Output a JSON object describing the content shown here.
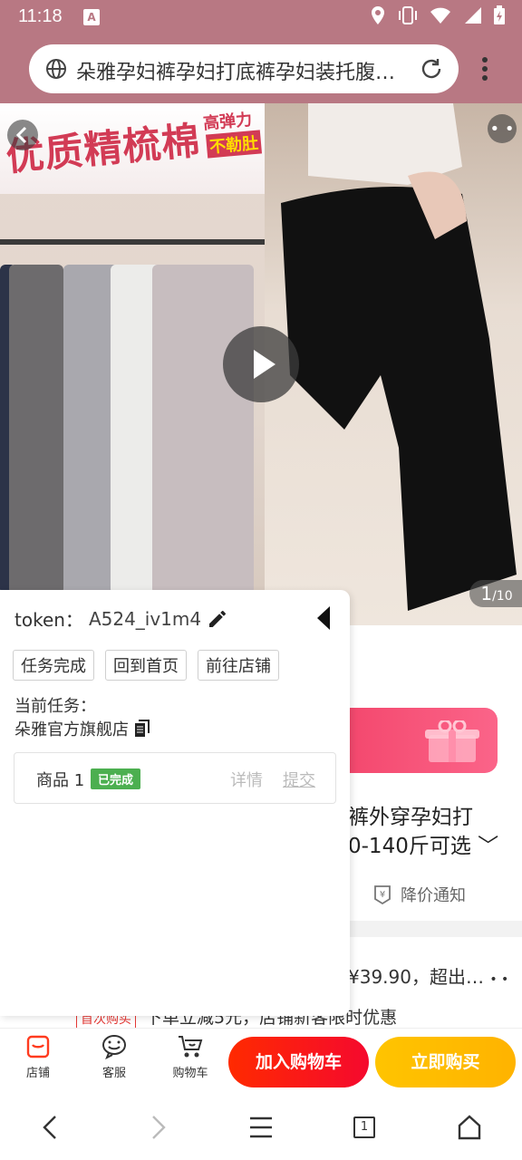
{
  "status_bar": {
    "time": "11:18",
    "notification_icon": "A"
  },
  "browser": {
    "url_title": "朵雅孕妇裤孕妇打底裤孕妇装托腹…",
    "tab_count": "1"
  },
  "hero": {
    "slogan_main": "优质精梳棉",
    "slogan_sub1": "高弹力",
    "slogan_sub2": "不勒肚",
    "counter_current": "1",
    "counter_total": "/10"
  },
  "panel": {
    "token_label": "token：",
    "token_value": "A524_iv1m4",
    "buttons": [
      "任务完成",
      "回到首页",
      "前往店铺"
    ],
    "task_label": "当前任务：",
    "task_name": "朵雅官方旗舰店",
    "card": {
      "name": "商品 1",
      "badge": "已完成",
      "detail": "详情",
      "submit": "提交"
    }
  },
  "page": {
    "title_line1": "裤外穿孕妇打",
    "title_line2": "0-140斤可选",
    "price_notify": "降价通知",
    "price_fragment": "¥39.90，超出…",
    "promo_tag": "首次购买",
    "promo_text": "下单立减5元，店铺新客限时优惠"
  },
  "action_bar": {
    "shop_label": "店铺",
    "service_label": "客服",
    "cart_label": "购物车",
    "add_to_cart": "加入购物车",
    "buy_now": "立即购买"
  },
  "colors": {
    "status_bar": "#b87883",
    "cart_button": "#f5092e",
    "buy_button": "#ffb300",
    "badge_green": "#4caf50"
  }
}
